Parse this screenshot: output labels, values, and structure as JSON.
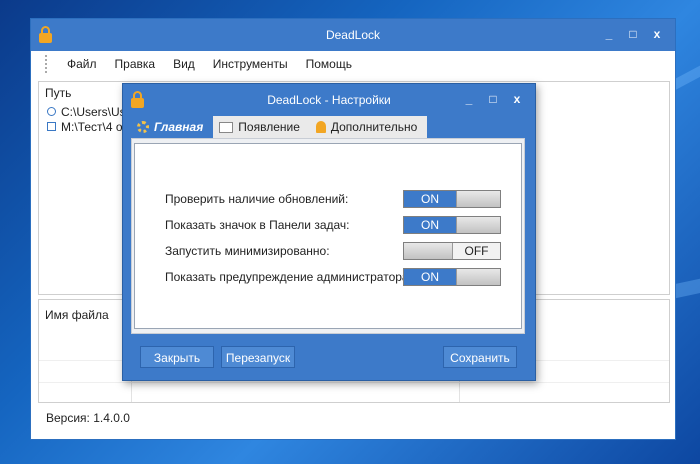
{
  "main_window": {
    "title": "DeadLock",
    "controls": {
      "minimize": "_",
      "maximize": "□",
      "close": "x"
    },
    "menu": [
      "Файл",
      "Правка",
      "Вид",
      "Инструменты",
      "Помощь"
    ],
    "path_panel": {
      "header": "Путь",
      "rows": [
        "C:\\Users\\Use",
        "M:\\Тест\\4 о"
      ]
    },
    "file_panel": {
      "header": "Имя файла"
    },
    "version": "Версия: 1.4.0.0"
  },
  "settings_dialog": {
    "title": "DeadLock - Настройки",
    "controls": {
      "minimize": "_",
      "maximize": "□",
      "close": "x"
    },
    "tabs": [
      {
        "label": "Главная",
        "icon": "gear-icon",
        "active": true
      },
      {
        "label": "Появление",
        "icon": "window-icon",
        "active": false
      },
      {
        "label": "Дополнительно",
        "icon": "bell-icon",
        "active": false
      }
    ],
    "options": [
      {
        "label": "Проверить наличие обновлений:",
        "state": "ON"
      },
      {
        "label": "Показать значок в Панели задач:",
        "state": "ON"
      },
      {
        "label": "Запустить минимизированно:",
        "state": "OFF"
      },
      {
        "label": "Показать предупреждение администратора:",
        "state": "ON"
      }
    ],
    "buttons": {
      "close": "Закрыть",
      "restart": "Перезапуск",
      "save": "Сохранить"
    }
  },
  "colors": {
    "accent": "#3d7ac9",
    "lock": "#f2a623",
    "desktop": "#1565c0"
  }
}
